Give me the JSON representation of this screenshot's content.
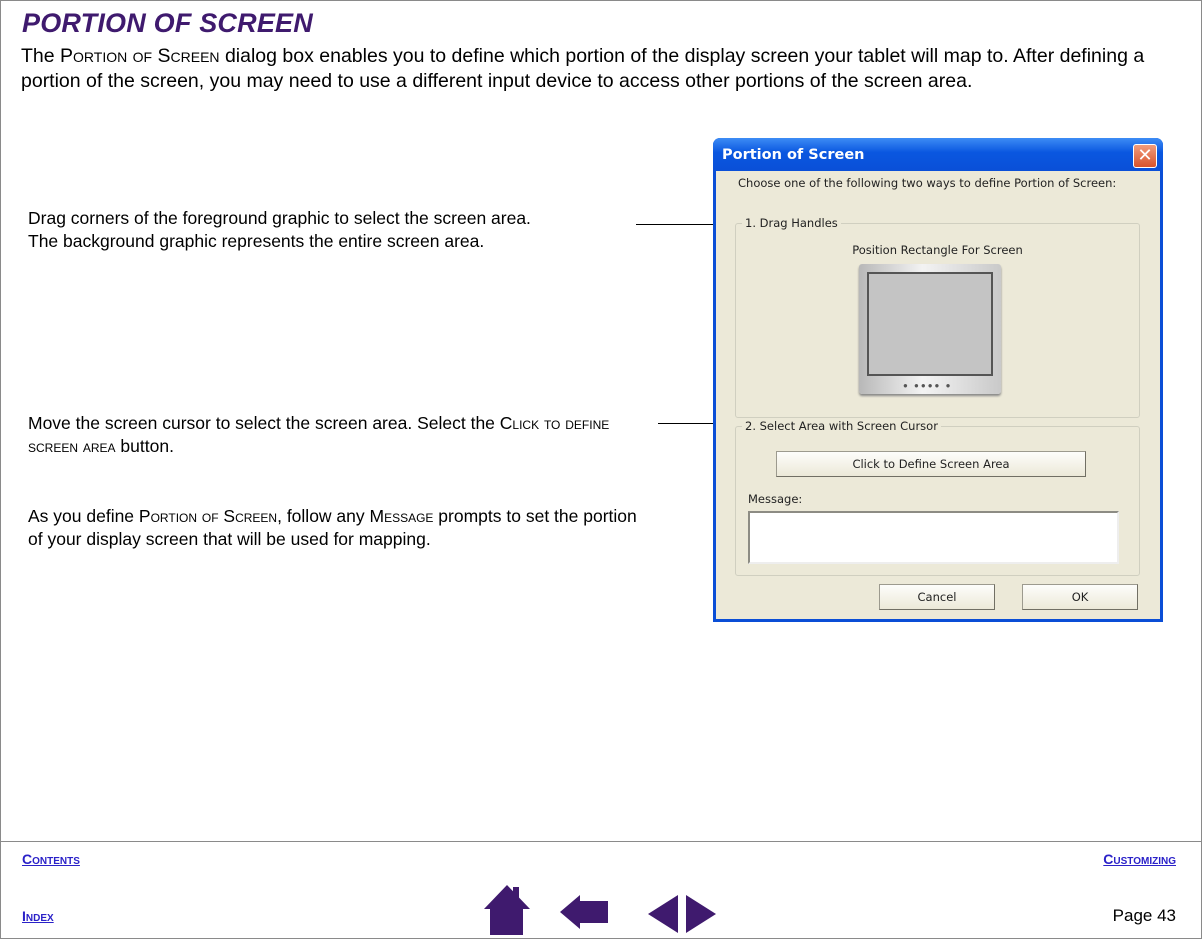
{
  "page": {
    "title": "PORTION OF SCREEN",
    "intro": {
      "p1": "The ",
      "sc1": "Portion of Screen",
      "p2": " dialog box enables you to define which portion of the display screen your tablet will map to. After defining a portion of the screen, you may need to use a different input device to access other portions of the screen area."
    },
    "callouts": {
      "drag": {
        "line1": "Drag corners of the foreground graphic to select the screen area.",
        "line2": "The background graphic represents the entire screen area."
      },
      "cursor": {
        "p1": "Move the screen cursor to select the screen area.  Select the ",
        "sc1": "Click to define screen area",
        "p2": " button."
      },
      "message": {
        "p1": "As you define ",
        "sc1": "Portion of Screen",
        "p2": ", follow any ",
        "sc2": "Message",
        "p3": " prompts to set the portion of your display screen that will be used for mapping."
      }
    }
  },
  "dialog": {
    "title": "Portion of Screen",
    "close_glyph": "✕",
    "prompt": "Choose one of the following two ways to define Portion of Screen:",
    "group1": {
      "legend": "1. Drag Handles",
      "label": "Position Rectangle For Screen",
      "monitor_buttons": "● ●●●● ●"
    },
    "group2": {
      "legend": "2. Select Area with Screen Cursor",
      "define_button": "Click to Define Screen Area",
      "message_label": "Message:",
      "message_value": ""
    },
    "cancel_label": "Cancel",
    "ok_label": "OK"
  },
  "footer": {
    "contents": "Contents",
    "customizing": "Customizing",
    "index": "Index",
    "page_label": "Page  43",
    "icon_color": "#3f1a6e"
  }
}
